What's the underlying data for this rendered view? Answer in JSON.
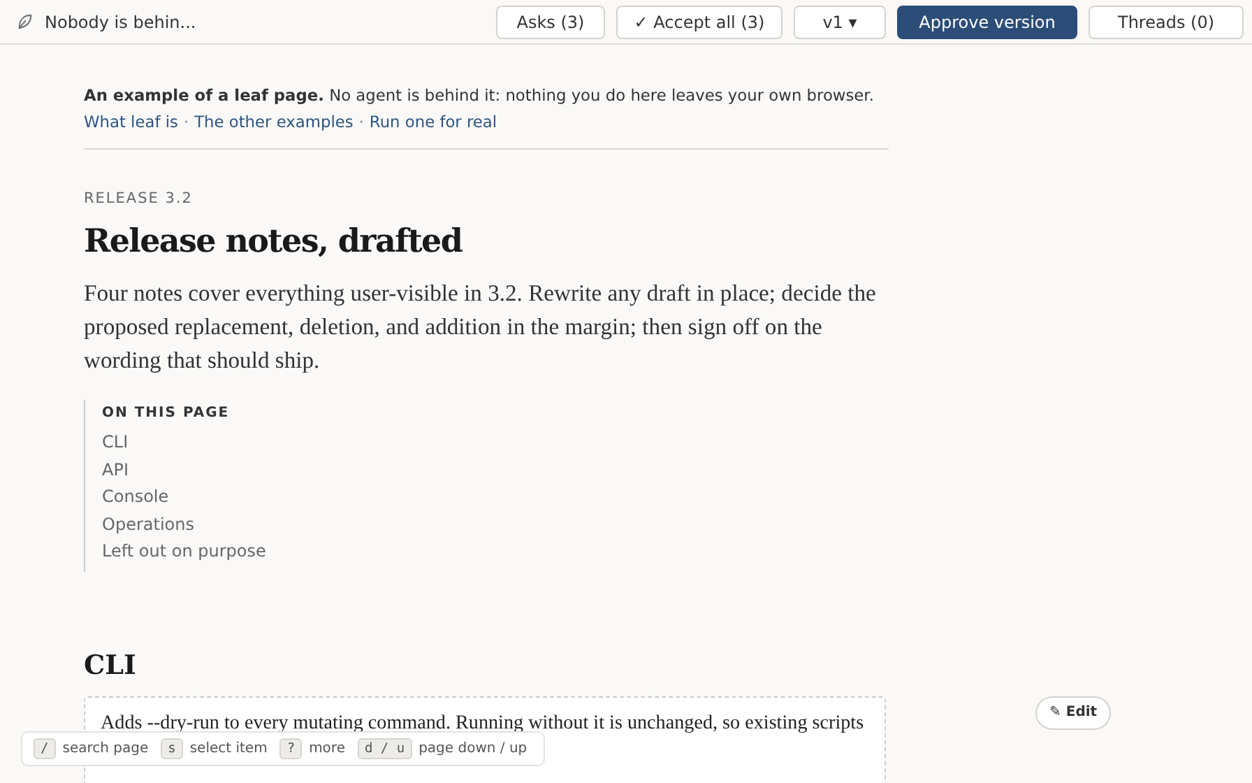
{
  "topbar": {
    "title": "Nobody is behin...",
    "buttons": [
      {
        "label": "Asks (3)",
        "kind": "plain"
      },
      {
        "label": "✓ Accept all (3)",
        "kind": "plain"
      },
      {
        "label": "v1 ▾",
        "kind": "plain"
      },
      {
        "label": "Approve version",
        "kind": "primary"
      },
      {
        "label": "Threads (0)",
        "kind": "plain"
      }
    ]
  },
  "notice": {
    "text": "**An example of a leaf page.** No agent is behind it: nothing you do here leaves your own browser.",
    "links": [
      "What leaf is",
      "The other examples",
      "Run one for real"
    ],
    "separator": "·"
  },
  "eyebrow": "RELEASE 3.2",
  "title": "Release notes, drafted",
  "lead": "Four notes cover everything user-visible in 3.2. Rewrite any draft in place; decide the proposed replacement, deletion, and addition in the margin; then sign off on the wording that should ship.",
  "toc": {
    "heading": "ON THIS PAGE",
    "items": [
      "CLI",
      "API",
      "Console",
      "Operations",
      "Left out on purpose"
    ]
  },
  "section": {
    "heading": "CLI",
    "draft": "Adds --dry-run to every mutating command. Running without it is unchanged, so existing scripts",
    "edit_button": "✎ Edit"
  },
  "shortcuts": [
    {
      "key": "/",
      "label": "search page"
    },
    {
      "key": "s",
      "label": "select item"
    },
    {
      "key": "?",
      "label": "more"
    },
    {
      "key": "d / u",
      "label": "page down / up"
    }
  ]
}
